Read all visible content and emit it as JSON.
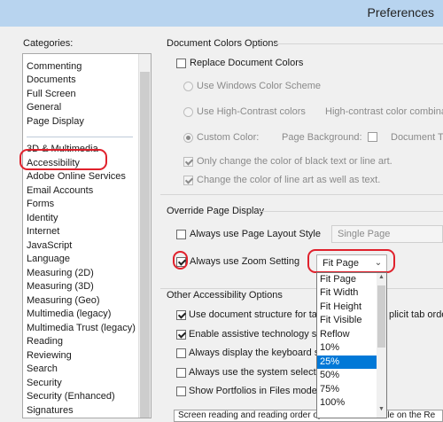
{
  "window": {
    "title": "Preferences"
  },
  "categories": {
    "label": "Categories:",
    "group1": [
      "Commenting",
      "Documents",
      "Full Screen",
      "General",
      "Page Display"
    ],
    "group2": [
      "3D & Multimedia",
      "Accessibility",
      "Adobe Online Services",
      "Email Accounts",
      "Forms",
      "Identity",
      "Internet",
      "JavaScript",
      "Language",
      "Measuring (2D)",
      "Measuring (3D)",
      "Measuring (Geo)",
      "Multimedia (legacy)",
      "Multimedia Trust (legacy)",
      "Reading",
      "Reviewing",
      "Search",
      "Security",
      "Security (Enhanced)",
      "Signatures"
    ],
    "selected": "Accessibility"
  },
  "document_colors": {
    "title": "Document Colors Options",
    "replace": "Replace Document Colors",
    "windows_scheme": "Use Windows Color Scheme",
    "high_contrast": "Use High-Contrast colors",
    "high_contrast_value": "High-contrast color combina",
    "custom_color": "Custom Color:",
    "page_background": "Page Background:",
    "document_text": "Document Te",
    "only_black": "Only change the color of black text or line art.",
    "line_art": "Change the color of line art as well as text."
  },
  "override": {
    "title": "Override Page Display",
    "layout_label": "Always use Page Layout Style",
    "layout_value": "Single Page",
    "zoom_label": "Always use Zoom Setting",
    "zoom_value": "Fit Page",
    "zoom_options": [
      "Fit Page",
      "Fit Width",
      "Fit Height",
      "Fit Visible",
      "Reflow",
      "10%",
      "25%",
      "50%",
      "75%",
      "100%"
    ],
    "zoom_highlighted": "25%"
  },
  "other": {
    "title": "Other Accessibility Options",
    "doc_structure": "Use document structure for tab",
    "doc_structure_suffix": "plicit tab orde",
    "assistive": "Enable assistive technology supp",
    "keyboard": "Always display the keyboard sele",
    "system_selection": "Always use the system selection",
    "portfolios": "Show Portfolios in Files mode",
    "status": "Screen reading and reading order options are available on the Re"
  },
  "colors": {
    "title_bar": "#b8d4ef",
    "highlight": "#e0212c",
    "selection": "#0078d7"
  }
}
